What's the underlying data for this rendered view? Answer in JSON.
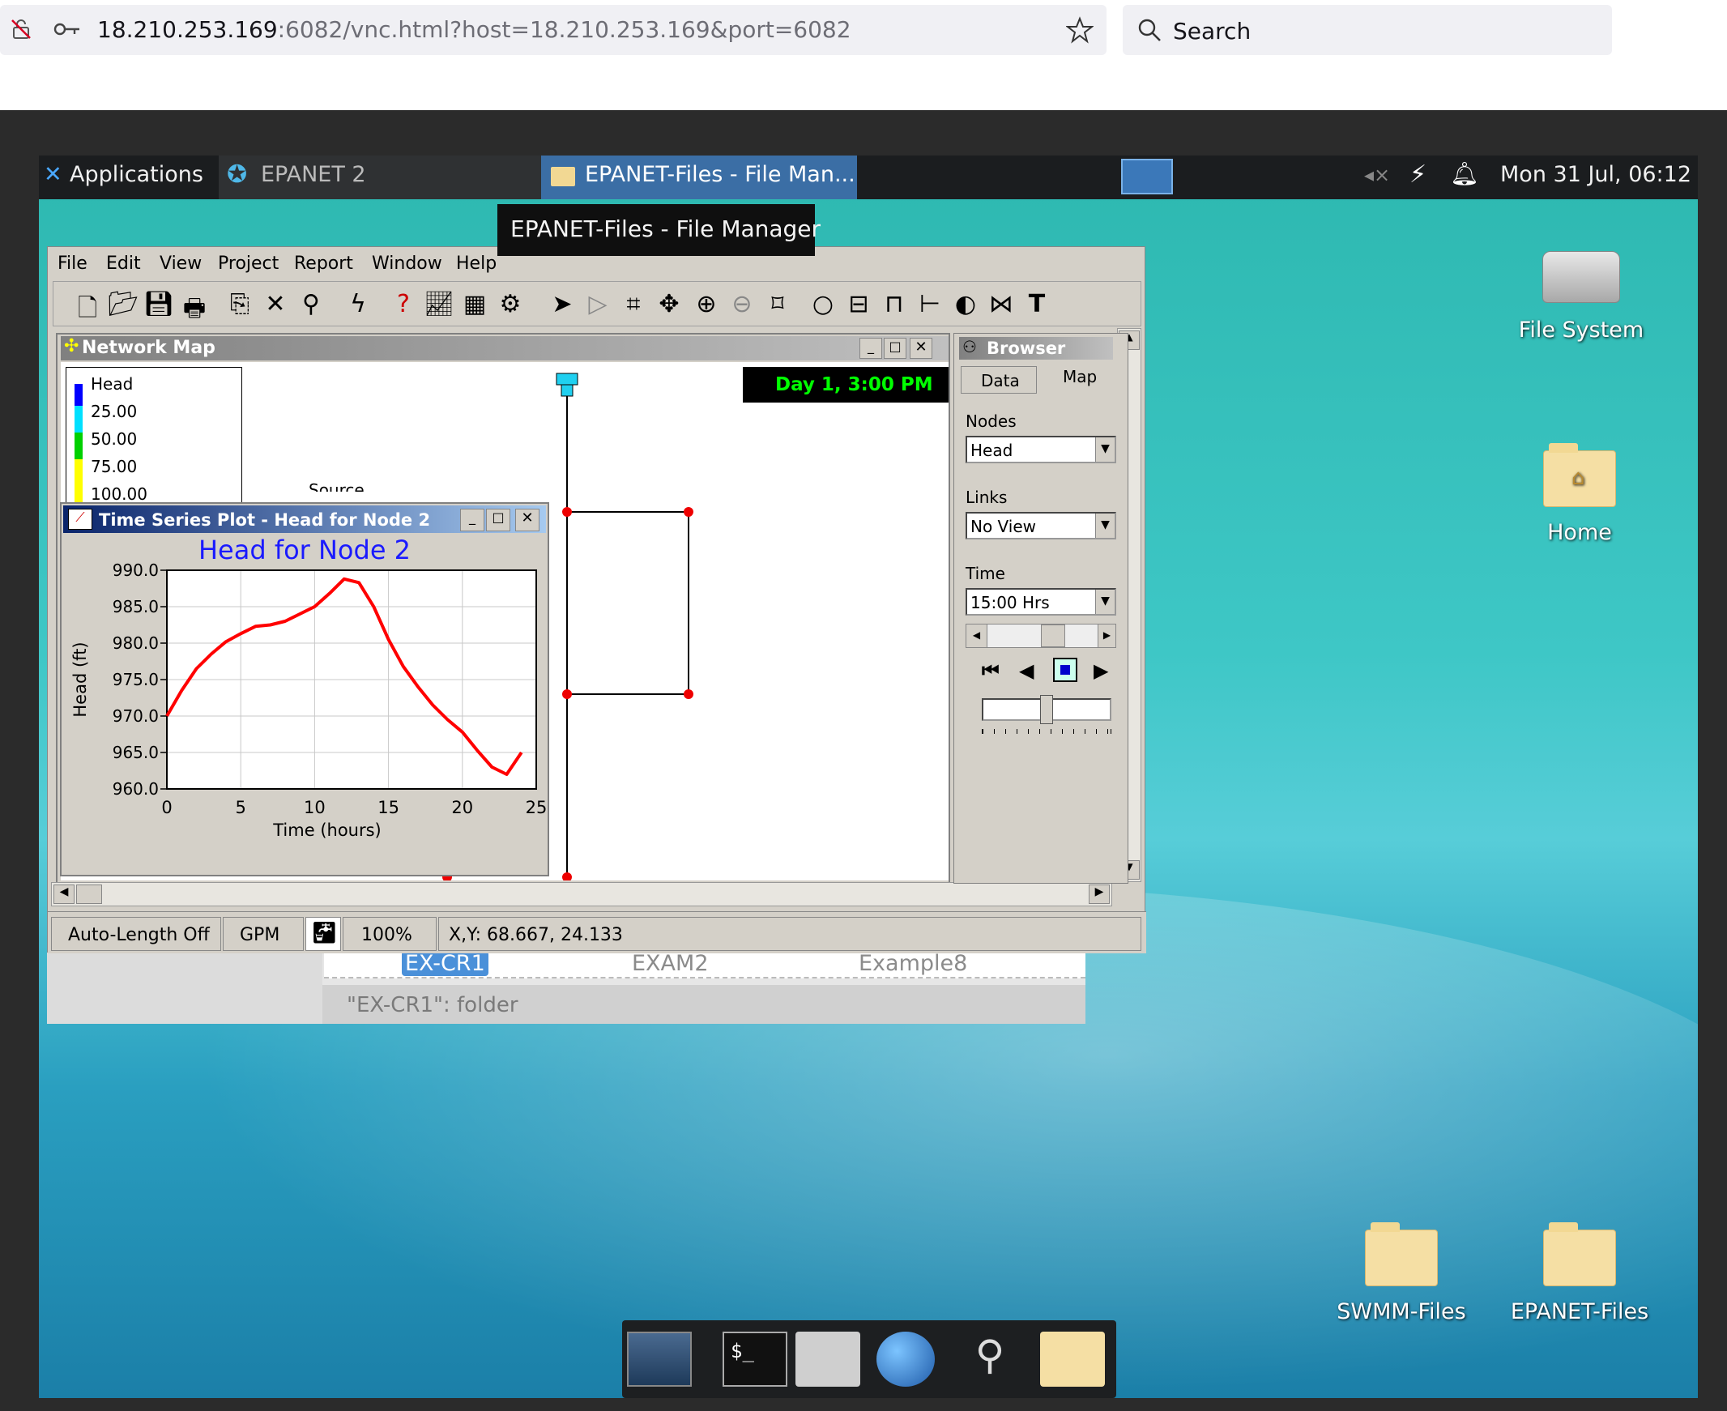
{
  "browser": {
    "url_host": "18.210.253.169",
    "url_rest": ":6082/vnc.html?host=18.210.253.169&port=6082",
    "search_label": "Search"
  },
  "panel": {
    "applications": "Applications",
    "task1": "EPANET 2",
    "task2": "EPANET-Files - File Man...",
    "clock": "Mon 31 Jul, 06:12"
  },
  "tooltip": "EPANET-Files - File Manager",
  "epanet": {
    "menu": [
      "File",
      "Edit",
      "View",
      "Project",
      "Report",
      "Window",
      "Help"
    ],
    "network_map_title": "Network Map",
    "legend": {
      "title": "Head",
      "values": [
        "25.00",
        "50.00",
        "75.00",
        "100.00"
      ],
      "colors": [
        "#0000ff",
        "#00e0ff",
        "#00d000",
        "#ffff00",
        "#ff0000"
      ]
    },
    "time_label": "Day 1, 3:00 PM",
    "source_label": "Source",
    "status": {
      "autolength": "Auto-Length Off",
      "units": "GPM",
      "zoom": "100%",
      "xy": "X,Y: 68.667, 24.133"
    },
    "browser_panel": {
      "title": "Browser",
      "tab_data": "Data",
      "tab_map": "Map",
      "nodes_label": "Nodes",
      "nodes_value": "Head",
      "links_label": "Links",
      "links_value": "No View",
      "time_label": "Time",
      "time_value": "15:00 Hrs"
    }
  },
  "time_series": {
    "window_title": "Time Series Plot - Head for Node 2",
    "chart_data": {
      "type": "line",
      "title": "Head for Node 2",
      "xlabel": "Time (hours)",
      "ylabel": "Head (ft)",
      "xlim": [
        0,
        25
      ],
      "ylim": [
        960,
        990
      ],
      "xticks": [
        0,
        5,
        10,
        15,
        20,
        25
      ],
      "yticks": [
        "990.0",
        "985.0",
        "980.0",
        "975.0",
        "970.0",
        "965.0",
        "960.0"
      ],
      "grid": true,
      "series": [
        {
          "color": "#ff0000",
          "x": [
            0,
            1,
            2,
            3,
            4,
            5,
            6,
            7,
            8,
            9,
            10,
            11,
            12,
            13,
            14,
            15,
            16,
            17,
            18,
            19,
            20,
            21,
            22,
            23,
            24
          ],
          "values": [
            970,
            973.5,
            976.5,
            978.5,
            980.2,
            981.3,
            982.3,
            982.5,
            983,
            984,
            985,
            986.8,
            988.8,
            988.3,
            985,
            980.5,
            976.8,
            974,
            971.5,
            969.5,
            967.8,
            965.3,
            963,
            962,
            965
          ]
        }
      ]
    }
  },
  "file_manager": {
    "items": [
      "EX-CR1",
      "EXAM2",
      "Example8"
    ],
    "status": "\"EX-CR1\": folder"
  },
  "desktop_icons": {
    "file_system": "File System",
    "home": "Home",
    "swmm": "SWMM-Files",
    "epanet_files": "EPANET-Files"
  }
}
